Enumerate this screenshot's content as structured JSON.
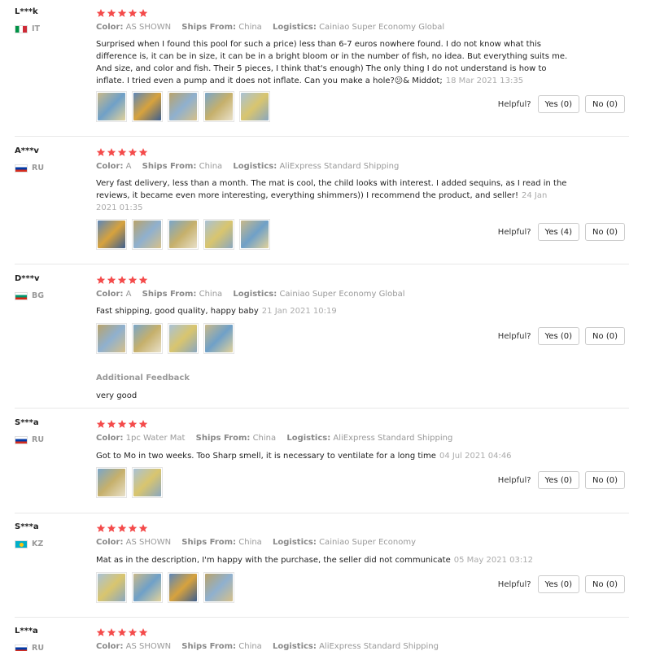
{
  "labels": {
    "color": "Color:",
    "ships_from": "Ships From:",
    "logistics": "Logistics:",
    "helpful": "Helpful?",
    "additional_feedback": "Additional Feedback"
  },
  "reviews": [
    {
      "user": "L***k",
      "country": "IT",
      "rating": 5,
      "color": "AS SHOWN",
      "ships_from": "China",
      "logistics": "Cainiao Super Economy Global",
      "text": "Surprised when I found this pool for such a price) less than 6-7 euros nowhere found. I do not know what this difference is, it can be in size, it can be in a bright bloom or in the number of fish, no idea. But everything suits me. And size, and color and fish. Their 5 pieces, I think that's enough) The only thing I do not understand is how to inflate. I tried even a pump and it does not inflate. Can you make a hole?😕& Middot;",
      "date": "18 Mar 2021 13:35",
      "photos": 5,
      "yes": "Yes (0)",
      "no": "No (0)"
    },
    {
      "user": "A***v",
      "country": "RU",
      "rating": 5,
      "color": "A",
      "ships_from": "China",
      "logistics": "AliExpress Standard Shipping",
      "text": "Very fast delivery, less than a month. The mat is cool, the child looks with interest. I added sequins, as I read in the reviews, it became even more interesting, everything shimmers)) I recommend the product, and seller!",
      "date": "24 Jan 2021 01:35",
      "photos": 5,
      "yes": "Yes (4)",
      "no": "No (0)"
    },
    {
      "user": "D***v",
      "country": "BG",
      "rating": 5,
      "color": "A",
      "ships_from": "China",
      "logistics": "Cainiao Super Economy Global",
      "text": "Fast shipping, good quality, happy baby",
      "date": "21 Jan 2021 10:19",
      "photos": 4,
      "yes": "Yes (0)",
      "no": "No (0)",
      "additional_feedback": "very good"
    },
    {
      "user": "S***a",
      "country": "RU",
      "rating": 5,
      "color": "1pc Water Mat",
      "ships_from": "China",
      "logistics": "AliExpress Standard Shipping",
      "text": "Got to Mo in two weeks. Too Sharp smell, it is necessary to ventilate for a long time",
      "date": "04 Jul 2021 04:46",
      "photos": 2,
      "yes": "Yes (0)",
      "no": "No (0)"
    },
    {
      "user": "S***a",
      "country": "KZ",
      "rating": 5,
      "color": "AS SHOWN",
      "ships_from": "China",
      "logistics": "Cainiao Super Economy",
      "text": "Mat as in the description, I'm happy with the purchase, the seller did not communicate",
      "date": "05 May 2021 03:12",
      "photos": 4,
      "yes": "Yes (0)",
      "no": "No (0)"
    },
    {
      "user": "L***a",
      "country": "RU",
      "rating": 5,
      "color": "AS SHOWN",
      "ships_from": "China",
      "logistics": "AliExpress Standard Shipping"
    }
  ],
  "colors": {
    "star": "#f44b4b",
    "button_border": "#cccccc",
    "divider": "#e8e8e8",
    "meta_text": "#999999"
  }
}
